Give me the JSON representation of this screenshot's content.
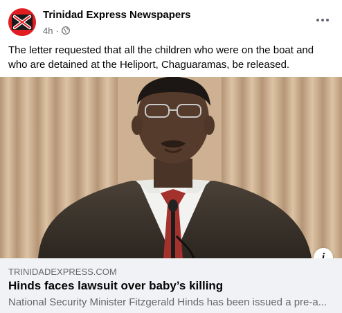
{
  "post": {
    "page_name": "Trinidad Express Newspapers",
    "timestamp": "4h",
    "separator": "·",
    "audience_icon": "globe-icon",
    "more_icon": "more-options-icon",
    "text": "The letter requested that all the children who were on the boat and who are detained at the Heliport, Chaguaramas, be released."
  },
  "link_preview": {
    "domain": "TRINIDADEXPRESS.COM",
    "title": "Hinds faces lawsuit over baby’s killing",
    "description": "National Security Minister Fitzgerald Hinds has been issued a pre-a...",
    "info_icon": "info-icon"
  },
  "colors": {
    "brand_red": "#e11d21",
    "name_text": "#050505",
    "secondary_text": "#65676b",
    "link_meta_background": "#f0f2f5"
  }
}
